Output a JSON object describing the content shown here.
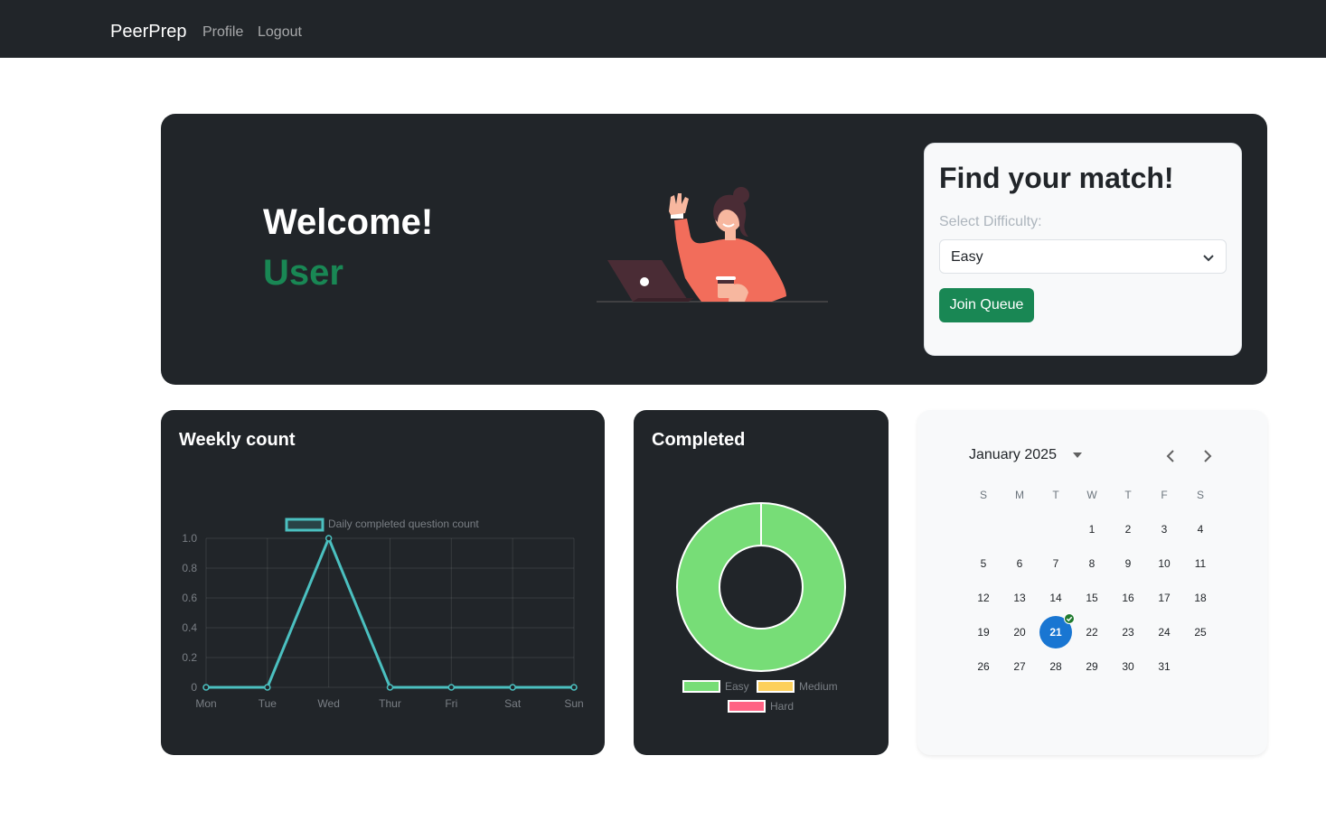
{
  "navbar": {
    "brand": "PeerPrep",
    "links": [
      "Profile",
      "Logout"
    ]
  },
  "hero": {
    "welcome": "Welcome!",
    "username": "User",
    "match": {
      "title": "Find your match!",
      "difficulty_label": "Select Difficulty:",
      "difficulty_value": "Easy",
      "join_label": "Join Queue"
    }
  },
  "colors": {
    "dark": "#212529",
    "accent": "#198754",
    "line": "#4bc0c0",
    "easy": "#77dd77",
    "medium": "#fdd05c",
    "hard": "#ff6384",
    "selected_day": "#1976d2"
  },
  "weekly": {
    "title": "Weekly count"
  },
  "completed": {
    "title": "Completed"
  },
  "chart_data": [
    {
      "type": "line",
      "categories": [
        "Mon",
        "Tue",
        "Wed",
        "Thur",
        "Fri",
        "Sat",
        "Sun"
      ],
      "series": [
        {
          "name": "Daily completed question count",
          "values": [
            0,
            0,
            1,
            0,
            0,
            0,
            0
          ]
        }
      ],
      "yticks": [
        "1.0",
        "0.8",
        "0.6",
        "0.4",
        "0.2",
        "0"
      ],
      "ylim": [
        0,
        1
      ],
      "legend": "top",
      "grid": true
    },
    {
      "type": "pie",
      "donut": true,
      "labels": [
        "Easy",
        "Medium",
        "Hard"
      ],
      "values": [
        1,
        0,
        0
      ],
      "legend": "bottom"
    }
  ],
  "calendar": {
    "month_label": "January 2025",
    "weekdays": [
      "S",
      "M",
      "T",
      "W",
      "T",
      "F",
      "S"
    ],
    "days": [
      [
        "",
        "",
        "",
        "1",
        "2",
        "3",
        "4"
      ],
      [
        "5",
        "6",
        "7",
        "8",
        "9",
        "10",
        "11"
      ],
      [
        "12",
        "13",
        "14",
        "15",
        "16",
        "17",
        "18"
      ],
      [
        "19",
        "20",
        "21",
        "22",
        "23",
        "24",
        "25"
      ],
      [
        "26",
        "27",
        "28",
        "29",
        "30",
        "31",
        ""
      ]
    ],
    "selected_day": "21",
    "completed_days": [
      "21"
    ]
  }
}
